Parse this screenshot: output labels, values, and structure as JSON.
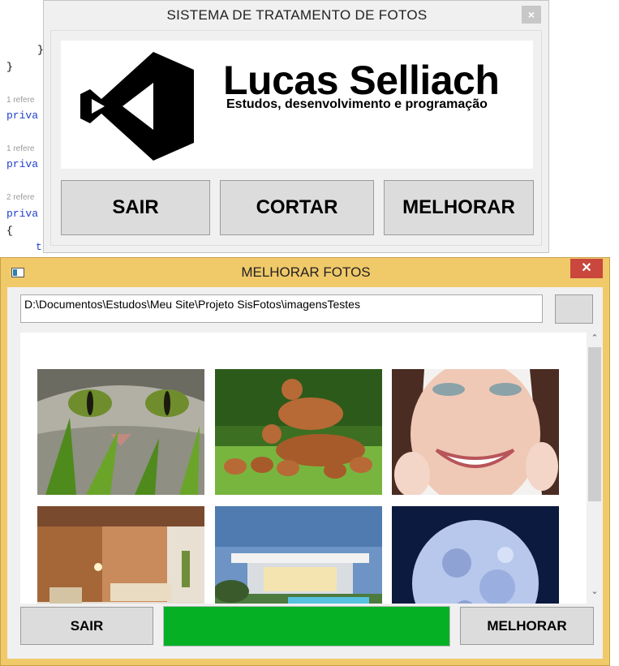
{
  "editor": {
    "lines": [
      "}",
      "}",
      "1 refere",
      "priva",
      "1 refere",
      "priva",
      "2 refere",
      "priva",
      "{",
      "t"
    ]
  },
  "main_window": {
    "title": "SISTEMA DE TRATAMENTO DE FOTOS",
    "close_glyph": "×",
    "logo": {
      "icon": "visual-studio-logo",
      "name": "Lucas Selliach",
      "subtitle": "Estudos, desenvolvimento e programação"
    },
    "buttons": {
      "exit": "SAIR",
      "crop": "CORTAR",
      "enhance": "MELHORAR"
    }
  },
  "enhance_window": {
    "title": "MELHORAR FOTOS",
    "close_glyph": "✕",
    "app_icon": "form-window-icon",
    "folder_path": "D:\\Documentos\\Estudos\\Meu Site\\Projeto SisFotos\\imagensTestes",
    "photos": [
      {
        "subject": "cat-face",
        "colors": [
          "#5f7d3a",
          "#9a9a86",
          "#3d4a2b"
        ]
      },
      {
        "subject": "boxer-dogs",
        "colors": [
          "#3f7a25",
          "#86c64a",
          "#b86a35"
        ]
      },
      {
        "subject": "smiling-woman",
        "colors": [
          "#f2d1c4",
          "#caa08e",
          "#4a2c22"
        ]
      },
      {
        "subject": "living-room",
        "colors": [
          "#c98b5c",
          "#7a4a2e",
          "#f0e2cc"
        ]
      },
      {
        "subject": "modern-house",
        "colors": [
          "#5a87b8",
          "#e0e6ee",
          "#3f7a45"
        ]
      },
      {
        "subject": "full-moon",
        "colors": [
          "#0c1a3f",
          "#c5d3f2",
          "#6f86c2"
        ]
      }
    ],
    "progress": {
      "fraction": 1.0,
      "color": "#06b025"
    },
    "buttons": {
      "exit": "SAIR",
      "enhance": "MELHORAR"
    },
    "scroll": {
      "up_glyph": "⌃",
      "down_glyph": "⌄"
    }
  }
}
